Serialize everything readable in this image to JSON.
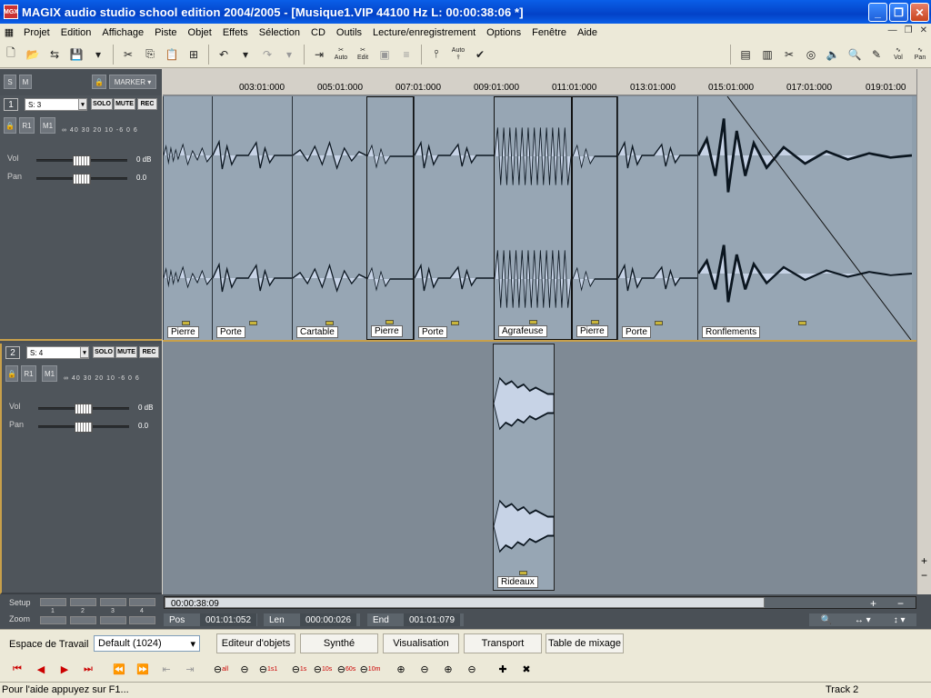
{
  "window": {
    "title": "MAGIX audio studio school edition 2004/2005 - [Musique1.VIP    44100 Hz L: 00:00:38:06 *]",
    "minimize": "_",
    "maximize": "❐",
    "close": "✕"
  },
  "menu": [
    "Projet",
    "Edition",
    "Affichage",
    "Piste",
    "Objet",
    "Effets",
    "Sélection",
    "CD",
    "Outils",
    "Lecture/enregistrement",
    "Options",
    "Fenêtre",
    "Aide"
  ],
  "toolbar": {
    "auto": "Auto",
    "edit": "Edit",
    "vol": "Vol",
    "pan": "Pan"
  },
  "left_panel": {
    "s": "S",
    "m": "M",
    "marker": "MARKER ▾"
  },
  "tracks": [
    {
      "num": "1",
      "name": "S: 3",
      "solo": "SOLO",
      "mute": "MUTE",
      "rec": "REC",
      "r": "R1",
      "mi": "M1",
      "meter": "∞ 40 30 20 10 -6 0 6",
      "vol_label": "Vol",
      "vol_value": "0 dB",
      "pan_label": "Pan",
      "pan_value": "0.0"
    },
    {
      "num": "2",
      "name": "S: 4",
      "solo": "SOLO",
      "mute": "MUTE",
      "rec": "REC",
      "r": "R1",
      "mi": "M1",
      "meter": "∞ 40 30 20 10 -6 0 6",
      "vol_label": "Vol",
      "vol_value": "0 dB",
      "pan_label": "Pan",
      "pan_value": "0.0"
    }
  ],
  "ruler": [
    "003:01:000",
    "005:01:000",
    "007:01:000",
    "009:01:000",
    "011:01:000",
    "013:01:000",
    "015:01:000",
    "017:01:000",
    "019:01:00"
  ],
  "objects_track1": [
    "Pierre",
    "Porte",
    "Cartable",
    "Pierre",
    "Porte",
    "Agrafeuse",
    "Pierre",
    "Porte",
    "Ronflements"
  ],
  "objects_track2": [
    "Rideaux"
  ],
  "scroll": {
    "position": "00:00:38:09",
    "plus": "+",
    "minus": "−"
  },
  "position": {
    "pos_label": "Pos",
    "pos_value": "001:01:052",
    "len_label": "Len",
    "len_value": "000:00:026",
    "end_label": "End",
    "end_value": "001:01:079"
  },
  "bottom_left": {
    "setup": "Setup",
    "zoom": "Zoom",
    "slots": [
      "1",
      "2",
      "3",
      "4"
    ]
  },
  "workspace": {
    "label": "Espace de Travail",
    "value": "Default (1024)"
  },
  "tabs": [
    "Editeur d'objets",
    "Synthé",
    "Visualisation",
    "Transport",
    "Table de mixage"
  ],
  "zoom_labels": {
    "all": "all",
    "1s": "1s",
    "10s": "10s",
    "60s": "60s",
    "10m": "10m",
    "1s1": "1s1"
  },
  "status": {
    "help": "Pour l'aide appuyez sur F1...",
    "track": "Track 2"
  }
}
